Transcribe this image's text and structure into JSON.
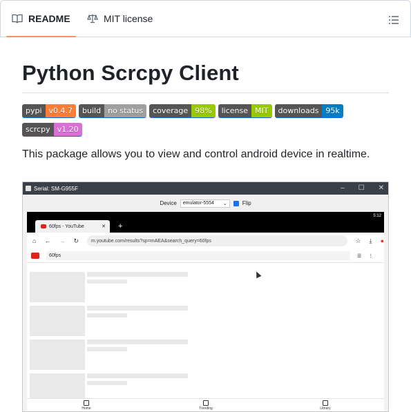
{
  "tabs": {
    "readme": "README",
    "license": "MIT license"
  },
  "heading": "Python Scrcpy Client",
  "badges": [
    [
      {
        "label": "pypi",
        "value": "v0.4.7",
        "color": "#fe7d37"
      },
      {
        "label": "build",
        "value": "no status",
        "color": "#9f9f9f"
      },
      {
        "label": "coverage",
        "value": "98%",
        "color": "#97ca00"
      },
      {
        "label": "license",
        "value": "MIT",
        "color": "#97ca00"
      },
      {
        "label": "downloads",
        "value": "95k",
        "color": "#007ec6"
      }
    ],
    [
      {
        "label": "scrcpy",
        "value": "v1.20",
        "color": "#da70d6"
      }
    ]
  ],
  "description": "This package allows you to view and control android device in realtime.",
  "screenshot": {
    "window_title": "Serial: SM-G955F",
    "device_label": "Device",
    "device_value": "emulator-5554",
    "flip_label": "Flip",
    "time": "5:12",
    "tab_title": "60fps - YouTube",
    "url": "m.youtube.com/results?sp=mAEA&search_query=60fps",
    "search_query": "60fps",
    "nav": [
      "Home",
      "Trending",
      "Library"
    ]
  },
  "icons": {
    "readme": "book-icon",
    "license": "scale-icon",
    "outline": "list-icon"
  }
}
